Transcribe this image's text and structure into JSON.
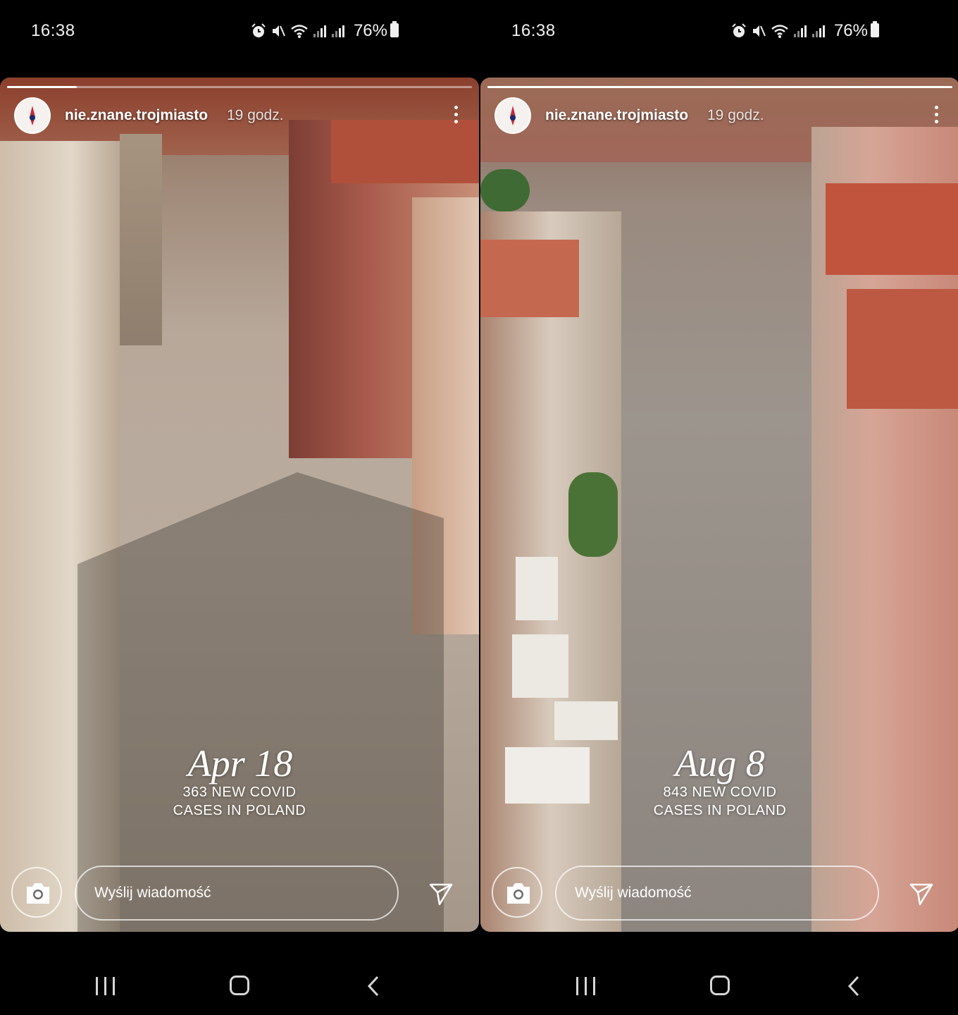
{
  "status_bar": {
    "time": "16:38",
    "battery": "76%",
    "icons": [
      "alarm-icon",
      "mute-icon",
      "wifi-icon",
      "signal-icon",
      "signal-icon",
      "battery-icon"
    ]
  },
  "story": {
    "username": "nie.znane.trojmiasto",
    "reply_placeholder": "Wyślij wiadomość"
  },
  "left": {
    "timeago": "19 godz.",
    "date": "Apr 18",
    "line1": "363 NEW COVID",
    "line2": "CASES IN POLAND"
  },
  "right": {
    "timeago": "19 godz.",
    "date": "Aug 8",
    "line1": "843 NEW COVID",
    "line2": "CASES IN POLAND"
  },
  "nav": [
    "recent-apps",
    "home",
    "back"
  ]
}
